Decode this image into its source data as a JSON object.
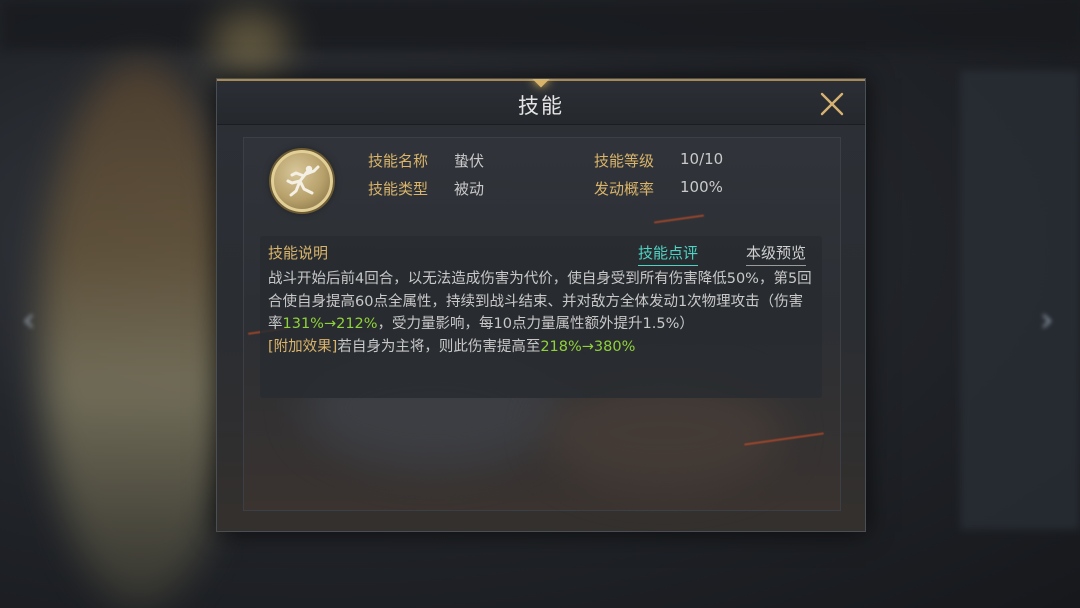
{
  "dialog": {
    "title": "技能",
    "close_icon": "close-icon"
  },
  "skill": {
    "icon": "leaping-figure-icon",
    "name_label": "技能名称",
    "name_value": "蛰伏",
    "type_label": "技能类型",
    "type_value": "被动",
    "level_label": "技能等级",
    "level_value": "10/10",
    "rate_label": "发动概率",
    "rate_value": "100%"
  },
  "description": {
    "title": "技能说明",
    "review_link": "技能点评",
    "preview_link": "本级预览",
    "part1": "战斗开始后前4回合，以无法造成伤害为代价，使自身受到所有伤害降低50%，第5回合使自身提高60点全属性，持续到战斗结束、并对敌方全体发动1次物理攻击（伤害率",
    "damage_rate": "131%→212%",
    "part2": "，受力量影响，每10点力量属性额外提升1.5%）",
    "extra_label": "[附加效果]",
    "extra_text": "若自身为主将，则此伤害提高至",
    "extra_rate": "218%→380%"
  },
  "colors": {
    "label_gold": "#d9b46a",
    "highlight_green": "#8fd23a",
    "link_teal": "#4fd3c3"
  }
}
